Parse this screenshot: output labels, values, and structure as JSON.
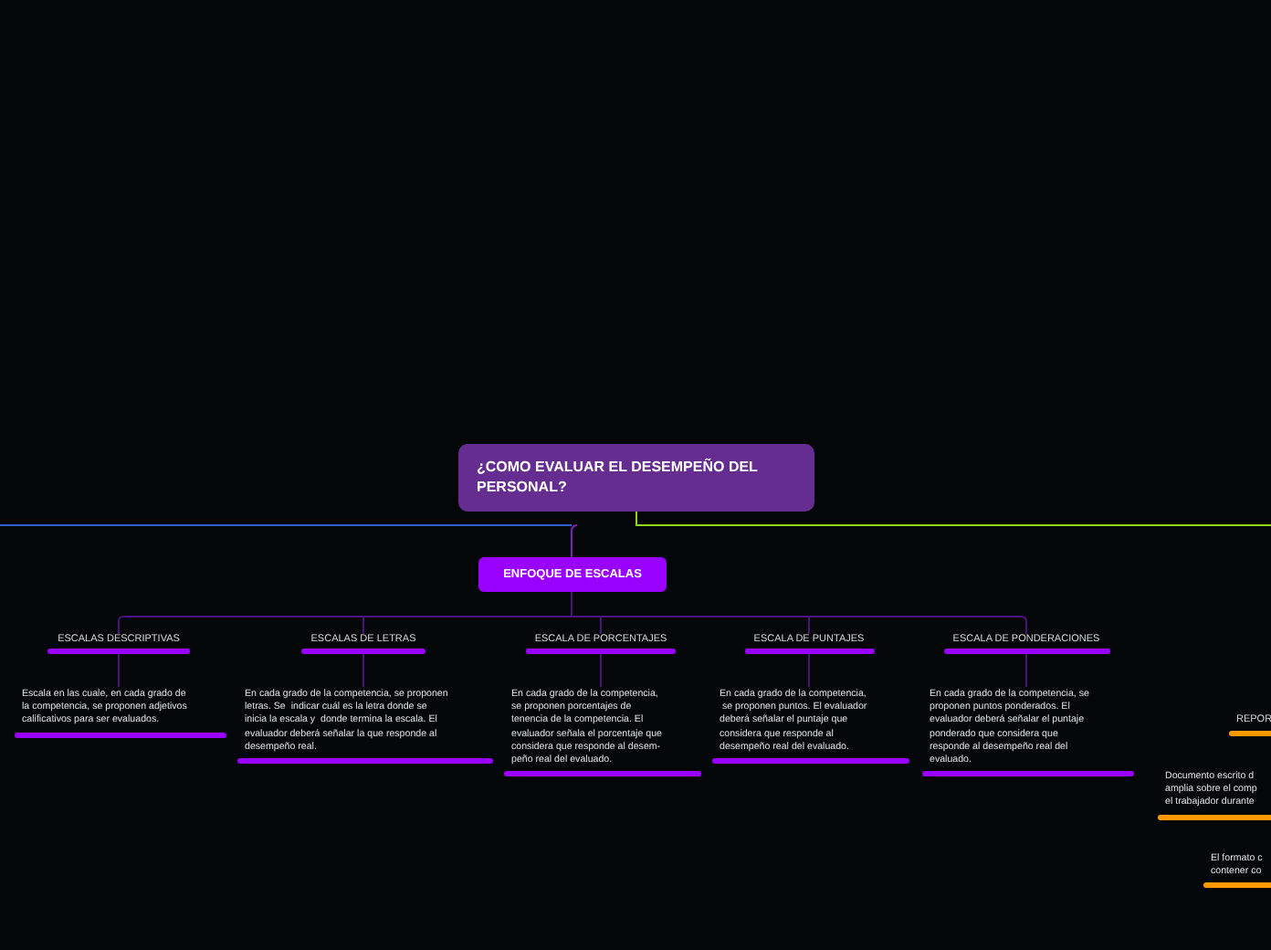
{
  "root": {
    "title": "¿COMO EVALUAR EL DESEMPEÑO DEL PERSONAL?"
  },
  "approach": {
    "title": "ENFOQUE DE ESCALAS"
  },
  "scales": [
    {
      "title": "ESCALAS DESCRIPTIVAS",
      "description": "Escala en las cuale, en cada grado de\nla competencia, se proponen adjetivos\ncalificativos para ser evaluados."
    },
    {
      "title": "ESCALAS DE LETRAS",
      "description": "En cada grado de la competencia, se proponen\nletras. Se  indicar cuál es la letra donde se\ninicia la escala y  donde termina la escala. El\nevaluador deberá señalar la que responde al\ndesempeño real."
    },
    {
      "title": "ESCALA DE PORCENTAJES",
      "description": "En cada grado de la competencia,\nse proponen porcentajes de\ntenencia de la competencia. El\nevaluador señala el porcentaje que\nconsidera que responde al desem-\npeño real del evaluado."
    },
    {
      "title": "ESCALA DE PUNTAJES",
      "description": "En cada grado de la competencia,\n se proponen puntos. El evaluador\ndeberá señalar el puntaje que\nconsidera que responde al\ndesempeño real del evaluado."
    },
    {
      "title": "ESCALA DE PONDERACIONES",
      "description": "En cada grado de la competencia, se\nproponen puntos ponderados. El\nevaluador deberá señalar el puntaje\nponderado que considera que\nresponde al desempeño real del\nevaluado."
    }
  ],
  "report_branch": [
    {
      "kind": "title",
      "text": "REPOR"
    },
    {
      "kind": "text",
      "text": "Documento escrito d\namplia sobre el comp\nel trabajador durante"
    },
    {
      "kind": "text",
      "text": "El formato c\ncontener co"
    }
  ]
}
